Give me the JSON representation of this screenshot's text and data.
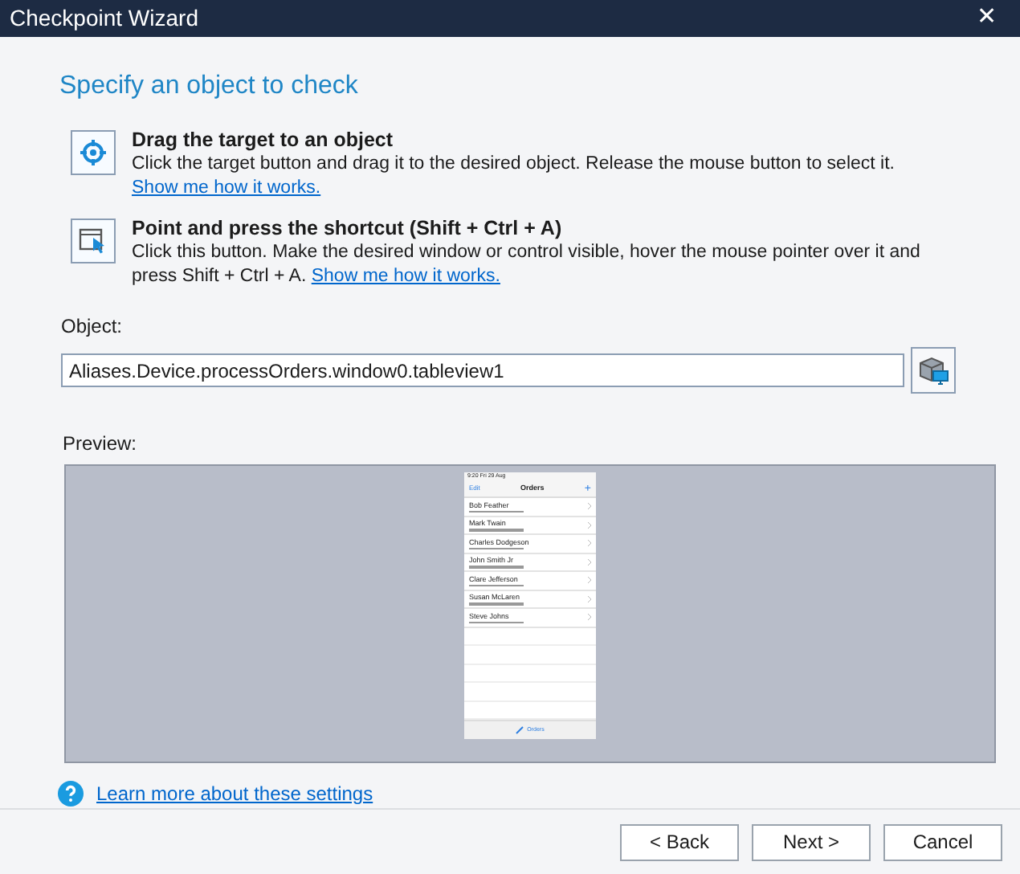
{
  "window": {
    "title": "Checkpoint Wizard",
    "close": "✕"
  },
  "heading": "Specify an object to check",
  "options": [
    {
      "kind": "target",
      "title": "Drag the target to an object",
      "text": "Click the target button and drag it to the desired object. Release the mouse button to select it.",
      "link": "Show me how it works."
    },
    {
      "kind": "pointer",
      "title": "Point and press the shortcut (Shift + Ctrl + A)",
      "text": "Click this button. Make the desired window or control visible, hover the mouse pointer over it and press Shift + Ctrl + A.",
      "link": "Show me how it works."
    }
  ],
  "object": {
    "label": "Object:",
    "value": "Aliases.Device.processOrders.window0.tableview1"
  },
  "preview": {
    "label": "Preview:",
    "phone": {
      "status": "9:20 Fri 29 Aug",
      "left": "Edit",
      "title": "Orders",
      "right": "+",
      "rows": [
        "Bob Feather",
        "Mark Twain",
        "Charles Dodgeson",
        "John Smith Jr",
        "Clare Jefferson",
        "Susan McLaren",
        "Steve Johns"
      ],
      "tab": "Orders"
    }
  },
  "help_link": "Learn more about these settings",
  "buttons": [
    "< Back",
    "Next >",
    "Cancel"
  ]
}
